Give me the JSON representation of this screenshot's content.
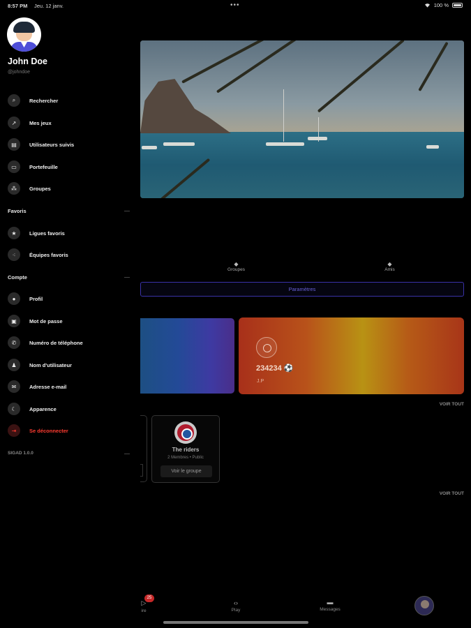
{
  "status_bar": {
    "time": "8:57 PM",
    "date": "Jeu. 12 janv.",
    "battery": "100 %"
  },
  "drawer": {
    "user": {
      "name": "John Doe",
      "handle": "@johndoe"
    },
    "menu": [
      {
        "label": "Rechercher",
        "icon": "search-icon"
      },
      {
        "label": "Mes jeux",
        "icon": "trend-icon"
      },
      {
        "label": "Utilisateurs suivis",
        "icon": "users-followed-icon"
      },
      {
        "label": "Portefeuille",
        "icon": "wallet-icon"
      },
      {
        "label": "Groupes",
        "icon": "groups-icon"
      }
    ],
    "favoris_title": "Favoris",
    "favoris": [
      {
        "label": "Ligues favoris",
        "icon": "star-icon"
      },
      {
        "label": "Équipes favoris",
        "icon": "teams-icon"
      }
    ],
    "compte_title": "Compte",
    "compte": [
      {
        "label": "Profil",
        "icon": "profile-icon"
      },
      {
        "label": "Mot de passe",
        "icon": "lock-icon"
      },
      {
        "label": "Numéro de téléphone",
        "icon": "phone-icon"
      },
      {
        "label": "Nom d'utilisateur",
        "icon": "user-icon"
      },
      {
        "label": "Adresse e-mail",
        "icon": "mail-icon"
      },
      {
        "label": "Apparence",
        "icon": "moon-icon"
      },
      {
        "label": "Se déconnecter",
        "icon": "logout-icon"
      }
    ],
    "version": "SIGAD 1.0.0"
  },
  "main": {
    "tabs": [
      {
        "label": "Groupes",
        "icon": "diamond-icon"
      },
      {
        "label": "Amis",
        "icon": "diamond-icon"
      }
    ],
    "parametres_label": "Paramètres",
    "wallet_card": {
      "number": "234234",
      "sub": "J.P"
    },
    "voir_tout_1": "VOIR TOUT",
    "group": {
      "name": "The riders",
      "meta": "2 Membres • Public",
      "button": "Voir le groupe"
    },
    "voir_tout_2": "VOIR TOUT"
  },
  "bottom_nav": {
    "items": [
      {
        "label": "ire",
        "icon": "play-outline-icon"
      },
      {
        "label": "Play",
        "icon": "code-icon"
      },
      {
        "label": "Messages",
        "icon": "chat-icon"
      }
    ],
    "badge": "25"
  },
  "colors": {
    "accent": "#3a32a8",
    "danger": "#ff3b30",
    "background": "#000000"
  }
}
